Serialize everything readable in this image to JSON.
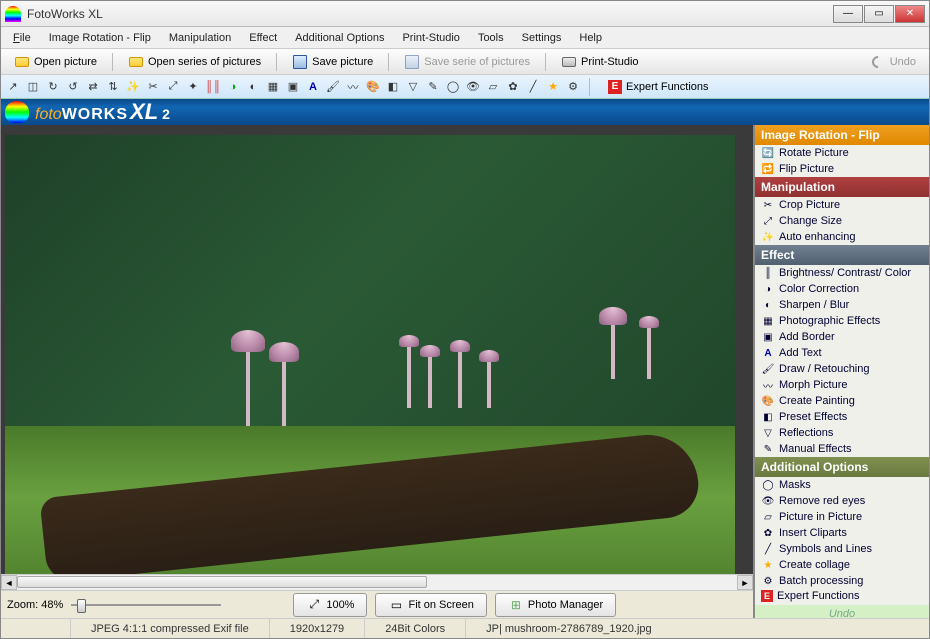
{
  "window": {
    "title": "FotoWorks XL"
  },
  "menu": {
    "file": "File",
    "rotation": "Image Rotation - Flip",
    "manipulation": "Manipulation",
    "effect": "Effect",
    "additional": "Additional Options",
    "printstudio": "Print-Studio",
    "tools": "Tools",
    "settings": "Settings",
    "help": "Help"
  },
  "toolbar1": {
    "open_picture": "Open picture",
    "open_series": "Open series of pictures",
    "save_picture": "Save picture",
    "save_series": "Save serie of pictures",
    "print_studio": "Print-Studio",
    "undo": "Undo"
  },
  "expert_functions": "Expert Functions",
  "banner": {
    "foto": "foto",
    "works": "WORKS",
    "xl": "XL",
    "two": "2"
  },
  "side": {
    "rotation_hdr": "Image Rotation - Flip",
    "rotate": "Rotate Picture",
    "flip": "Flip Picture",
    "manip_hdr": "Manipulation",
    "crop": "Crop Picture",
    "resize": "Change Size",
    "auto": "Auto enhancing",
    "effect_hdr": "Effect",
    "bcc": "Brightness/ Contrast/ Color",
    "colorcorr": "Color Correction",
    "sharpen": "Sharpen / Blur",
    "photofx": "Photographic Effects",
    "border": "Add Border",
    "text": "Add Text",
    "draw": "Draw / Retouching",
    "morph": "Morph Picture",
    "paint": "Create Painting",
    "preset": "Preset Effects",
    "reflect": "Reflections",
    "manualfx": "Manual Effects",
    "addl_hdr": "Additional Options",
    "masks": "Masks",
    "redeye": "Remove red eyes",
    "pip": "Picture in Picture",
    "clipart": "Insert Cliparts",
    "symbols": "Symbols and Lines",
    "collage": "Create collage",
    "batch": "Batch processing",
    "expert": "Expert Functions",
    "undo": "Undo"
  },
  "bottom": {
    "zoom_label": "Zoom: 48%",
    "btn_100": "100%",
    "btn_fit": "Fit on Screen",
    "btn_mgr": "Photo Manager"
  },
  "status": {
    "format": "JPEG 4:1:1 compressed Exif file",
    "dims": "1920x1279",
    "depth": "24Bit Colors",
    "filename": "JP| mushroom-2786789_1920.jpg"
  }
}
